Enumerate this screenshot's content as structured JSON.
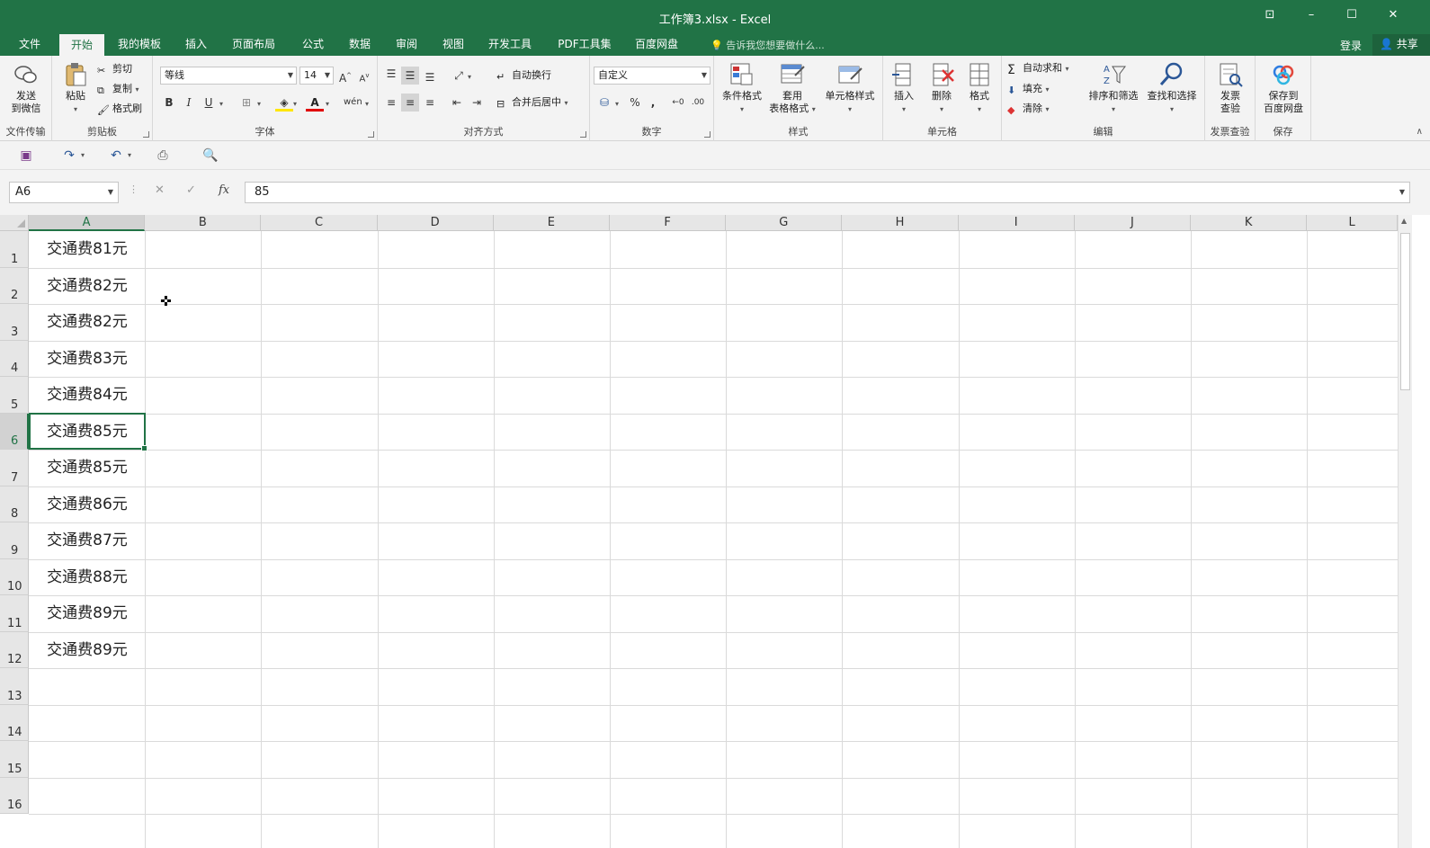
{
  "window": {
    "title": "工作簿3.xlsx - Excel",
    "controls": [
      "⊡",
      "–",
      "☐",
      "✕"
    ]
  },
  "tabs": [
    "文件",
    "开始",
    "我的模板",
    "插入",
    "页面布局",
    "公式",
    "数据",
    "审阅",
    "视图",
    "开发工具",
    "PDF工具集",
    "百度网盘"
  ],
  "active_tab": "开始",
  "tell_me": "告诉我您想要做什么...",
  "login": "登录",
  "share": "共享",
  "ribbon": {
    "groups": {
      "file_transfer": "文件传输",
      "clipboard": "剪贴板",
      "font": "字体",
      "alignment": "对齐方式",
      "number": "数字",
      "styles": "样式",
      "cells": "单元格",
      "editing": "编辑",
      "invoice": "发票查验",
      "save": "保存"
    },
    "send_wechat": [
      "发送",
      "到微信"
    ],
    "paste": "粘贴",
    "cut": "剪切",
    "copy": "复制",
    "format_painter": "格式刷",
    "font_name": "等线",
    "font_size": "14",
    "wrap_text": "自动换行",
    "merge_center": "合并后居中",
    "number_format": "自定义",
    "conditional_format": "条件格式",
    "table_format": [
      "套用",
      "表格格式"
    ],
    "cell_styles": "单元格样式",
    "insert": "插入",
    "delete": "删除",
    "format": "格式",
    "autosum": "自动求和",
    "fill": "填充",
    "clear": "清除",
    "sort_filter": "排序和筛选",
    "find_select": "查找和选择",
    "invoice_check": [
      "发票",
      "查验"
    ],
    "save_baidu": [
      "保存到",
      "百度网盘"
    ]
  },
  "formula_bar": {
    "name_box": "A6",
    "formula": "85",
    "fx": "fx"
  },
  "columns": [
    "A",
    "B",
    "C",
    "D",
    "E",
    "F",
    "G",
    "H",
    "I",
    "J",
    "K",
    "L"
  ],
  "rows": [
    "1",
    "2",
    "3",
    "4",
    "5",
    "6",
    "7",
    "8",
    "9",
    "10",
    "11",
    "12",
    "13",
    "14",
    "15",
    "16"
  ],
  "cells_A": [
    "交通费81元",
    "交通费82元",
    "交通费82元",
    "交通费83元",
    "交通费84元",
    "交通费85元",
    "交通费85元",
    "交通费86元",
    "交通费87元",
    "交通费88元",
    "交通费89元",
    "交通费89元"
  ],
  "colors": {
    "accent": "#217346"
  }
}
